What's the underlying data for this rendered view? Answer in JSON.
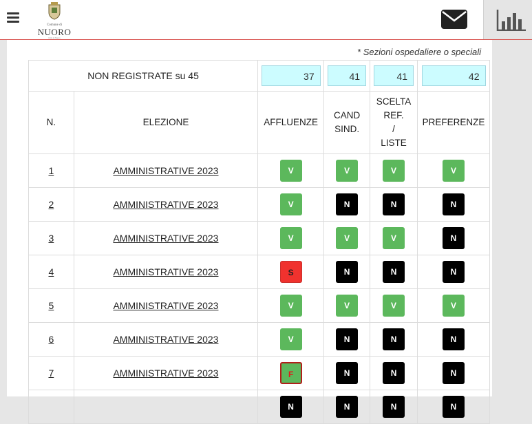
{
  "header": {
    "logo": {
      "small_text": "Comune di",
      "name": "NUORO",
      "tiny_text": "Città di Nuoro"
    },
    "icons": {
      "menu": "hamburger-icon",
      "mail": "envelope-icon",
      "stats": "bar-chart-icon"
    }
  },
  "note": "* Sezioni ospedaliere o speciali",
  "summary": {
    "label": "NON REGISTRATE su 45",
    "affluenze": "37",
    "cand_sind": "41",
    "scelta": "41",
    "preferenze": "42"
  },
  "columns": {
    "n": "N.",
    "elezione": "ELEZIONE",
    "affluenze": "AFFLUENZE",
    "cand1": "CAND",
    "cand2": "SIND.",
    "scelta1": "SCELTA",
    "scelta2": "REF.",
    "scelta3": "/",
    "scelta4": "LISTE",
    "preferenze": "PREFERENZE"
  },
  "rows": [
    {
      "n": "1",
      "elezione": "AMMINISTRATIVE 2023",
      "affluenze": "V",
      "cand": "V",
      "scelta": "V",
      "pref": "V"
    },
    {
      "n": "2",
      "elezione": "AMMINISTRATIVE 2023",
      "affluenze": "V",
      "cand": "N",
      "scelta": "N",
      "pref": "N"
    },
    {
      "n": "3",
      "elezione": "AMMINISTRATIVE 2023",
      "affluenze": "V",
      "cand": "V",
      "scelta": "V",
      "pref": "N"
    },
    {
      "n": "4",
      "elezione": "AMMINISTRATIVE 2023",
      "affluenze": "S",
      "cand": "N",
      "scelta": "N",
      "pref": "N"
    },
    {
      "n": "5",
      "elezione": "AMMINISTRATIVE 2023",
      "affluenze": "V",
      "cand": "V",
      "scelta": "V",
      "pref": "V"
    },
    {
      "n": "6",
      "elezione": "AMMINISTRATIVE 2023",
      "affluenze": "V",
      "cand": "N",
      "scelta": "N",
      "pref": "N"
    },
    {
      "n": "7",
      "elezione": "AMMINISTRATIVE 2023",
      "affluenze": "F",
      "cand": "N",
      "scelta": "N",
      "pref": "N"
    },
    {
      "n": "",
      "elezione": "",
      "affluenze": "N",
      "cand": "N",
      "scelta": "N",
      "pref": "N"
    }
  ]
}
